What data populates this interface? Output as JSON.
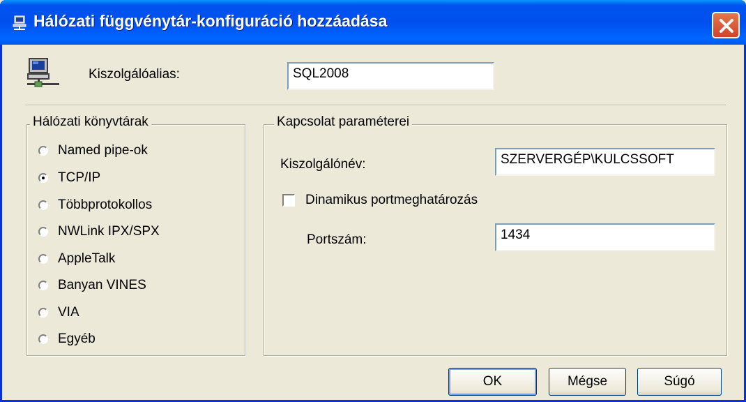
{
  "window": {
    "title": "Hálózati függvénytár-konfiguráció hozzáadása",
    "title_icon": "network-computer-icon",
    "close_icon": "close-icon",
    "accent": "#0054e3",
    "close_color": "#d2432b"
  },
  "alias": {
    "label": "Kiszolgálóalias:",
    "value": "SQL2008",
    "icon": "server-icon"
  },
  "libraries": {
    "caption": "Hálózati könyvtárak",
    "items": [
      {
        "label": "Named pipe-ok",
        "checked": false
      },
      {
        "label": "TCP/IP",
        "checked": true
      },
      {
        "label": "Többprotokollos",
        "checked": false
      },
      {
        "label": "NWLink IPX/SPX",
        "checked": false
      },
      {
        "label": "AppleTalk",
        "checked": false
      },
      {
        "label": "Banyan VINES",
        "checked": false
      },
      {
        "label": "VIA",
        "checked": false
      },
      {
        "label": "Egyéb",
        "checked": false
      }
    ]
  },
  "connection": {
    "caption": "Kapcsolat paraméterei",
    "server_label": "Kiszolgálónév:",
    "server_value": "SZERVERGÉP\\KULCSSOFT",
    "dynamic_port_label": "Dinamikus portmeghatározás",
    "dynamic_port_checked": false,
    "port_label": "Portszám:",
    "port_value": "1434"
  },
  "buttons": {
    "ok": "OK",
    "cancel": "Mégse",
    "help": "Súgó"
  }
}
